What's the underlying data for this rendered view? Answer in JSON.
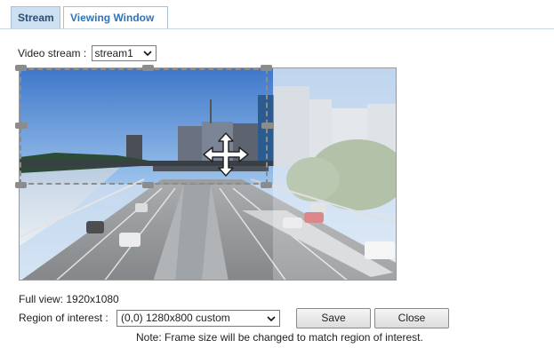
{
  "tabs": [
    {
      "label": "Stream"
    },
    {
      "label": "Viewing Window"
    }
  ],
  "stream": {
    "label": "Video stream :",
    "selected": "stream1"
  },
  "full_view_text": "Full view: 1920x1080",
  "roi": {
    "label": "Region of interest :",
    "selected": "(0,0) 1280x800 custom"
  },
  "buttons": {
    "save": "Save",
    "close": "Close"
  },
  "note": "Note: Frame size will be changed to match region of interest.",
  "icons": {
    "dropdown": "chevron-down-icon",
    "move": "move-arrows-icon"
  },
  "colors": {
    "active_tab_bg": "#cde0f1",
    "tab_text": "#2f73b9",
    "roi_border": "#8c8c8c"
  }
}
